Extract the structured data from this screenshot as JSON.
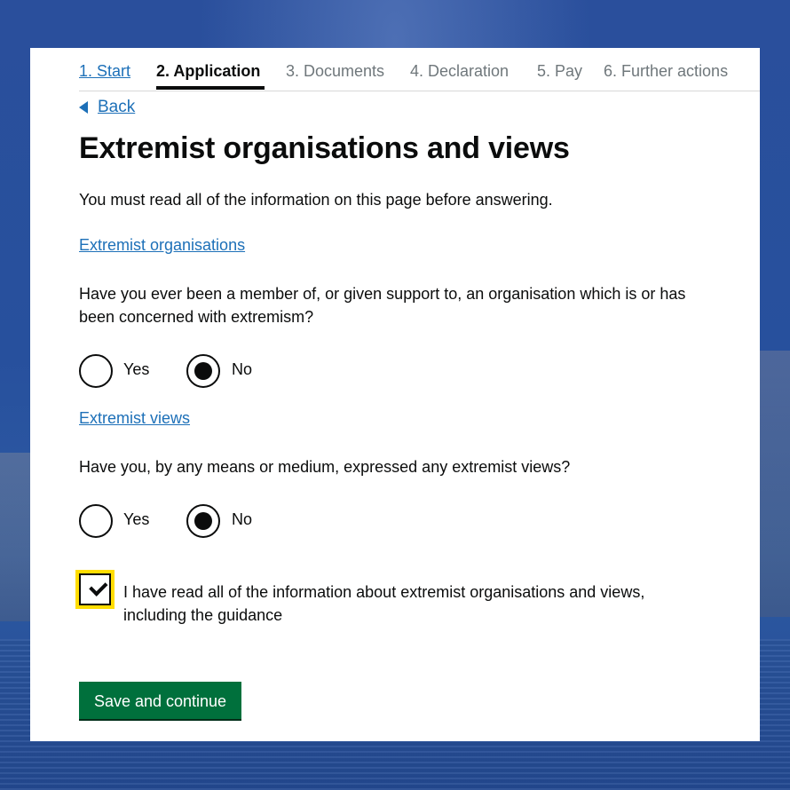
{
  "nav": {
    "steps": [
      {
        "label": "1. Start"
      },
      {
        "label": "2. Application"
      },
      {
        "label": "3. Documents"
      },
      {
        "label": "4. Declaration"
      },
      {
        "label": "5. Pay"
      },
      {
        "label": "6. Further actions"
      }
    ],
    "current_step": 2
  },
  "back_link": "Back",
  "page_title": "Extremist organisations and views",
  "intro": "You must read all of the information on this page before answering.",
  "section1": {
    "link": "Extremist organisations",
    "question": "Have you ever been a member of, or given support to, an organisation which is or has been concerned with extremism?",
    "options": [
      "Yes",
      "No"
    ],
    "selected": "No"
  },
  "section2": {
    "link": "Extremist views",
    "question": "Have you, by any means or medium, expressed any extremist views?",
    "options": [
      "Yes",
      "No"
    ],
    "selected": "No"
  },
  "confirmation": {
    "label": "I have read all of the information about extremist organisations and views, including the guidance",
    "checked": true
  },
  "button_label": "Save and continue",
  "colors": {
    "link": "#1d70b8",
    "button": "#00703c",
    "focus": "#ffdd00",
    "background": "#2a4f9c"
  }
}
